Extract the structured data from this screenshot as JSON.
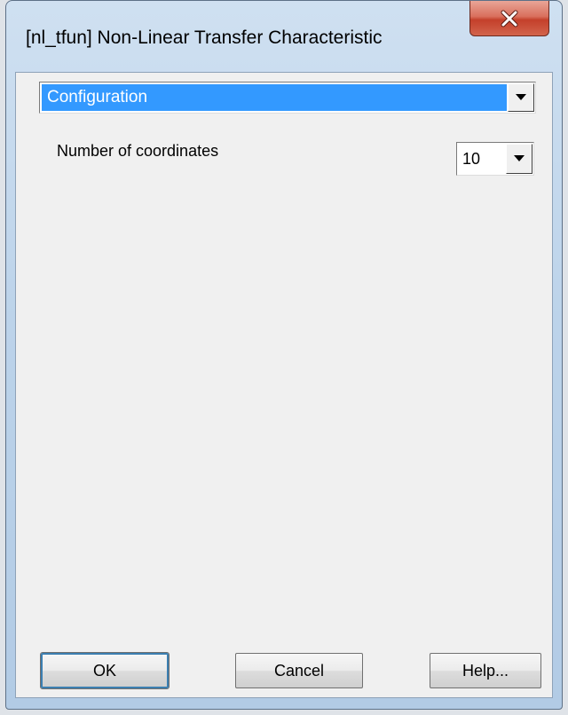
{
  "window": {
    "title": "[nl_tfun] Non-Linear Transfer Characteristic"
  },
  "section_select": {
    "value": "Configuration",
    "icon": "chevron-down-icon"
  },
  "coordinates": {
    "label": "Number of coordinates",
    "value": "10",
    "icon": "chevron-down-icon"
  },
  "buttons": {
    "ok": "OK",
    "cancel": "Cancel",
    "help": "Help..."
  },
  "colors": {
    "selection": "#3399ff",
    "client_bg": "#f0f0f0",
    "close_button": "#c4402b"
  }
}
